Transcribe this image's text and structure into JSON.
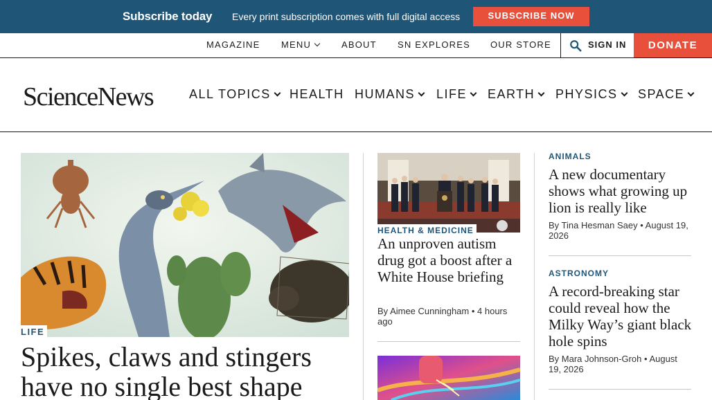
{
  "banner": {
    "title": "Subscribe today",
    "description": "Every print subscription comes with full digital access",
    "button": "SUBSCRIBE NOW"
  },
  "utility_nav": {
    "items": [
      "MAGAZINE",
      "MENU",
      "ABOUT",
      "SN EXPLORES",
      "OUR STORE"
    ],
    "search_icon": "search-icon",
    "sign_in": "SIGN IN",
    "donate": "DONATE"
  },
  "logo": "ScienceNews",
  "main_nav": [
    "ALL TOPICS",
    "HEALTH",
    "HUMANS",
    "LIFE",
    "EARTH",
    "PHYSICS",
    "SPACE"
  ],
  "colors": {
    "banner_bg": "#1f5577",
    "accent": "#e8503c",
    "category": "#1f5577"
  },
  "hero": {
    "category": "LIFE",
    "title": "Spikes, claws and stingers have no single best shape"
  },
  "middle": {
    "story1": {
      "category": "HEALTH & MEDICINE",
      "title": "An unproven autism drug got a boost after a White House briefing",
      "byline": "By Aimee Cunningham • 4 hours ago"
    }
  },
  "sidebar": {
    "story1": {
      "category": "ANIMALS",
      "title": "A new documentary shows what growing up lion is really like",
      "byline": "By Tina Hesman Saey • August 19, 2026"
    },
    "story2": {
      "category": "ASTRONOMY",
      "title": "A record-breaking star could reveal how the Milky Way’s giant black hole spins",
      "byline": "By Mara Johnson-Groh • August 19, 2026"
    }
  }
}
